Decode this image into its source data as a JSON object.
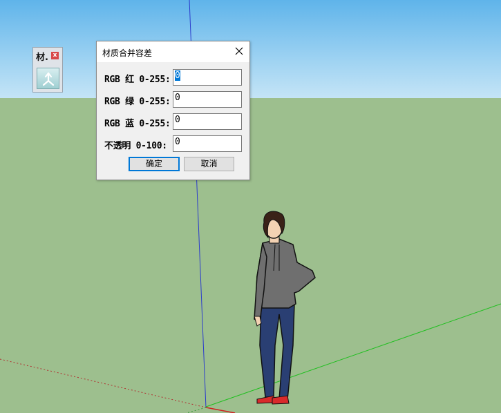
{
  "toolbar": {
    "title": "材.",
    "close_label": "x"
  },
  "dialog": {
    "title": "材质合并容差",
    "fields": [
      {
        "label": "RGB 红 0-255:",
        "value": "0",
        "selected": true
      },
      {
        "label": "RGB 绿 0-255:",
        "value": "0"
      },
      {
        "label": "RGB 蓝 0-255:",
        "value": "0"
      },
      {
        "label": "不透明 0-100:",
        "value": "0"
      }
    ],
    "ok_label": "确定",
    "cancel_label": "取消"
  },
  "colors": {
    "sky": "#9dd2f2",
    "ground": "#9dbf8e",
    "accent": "#0078d7"
  }
}
